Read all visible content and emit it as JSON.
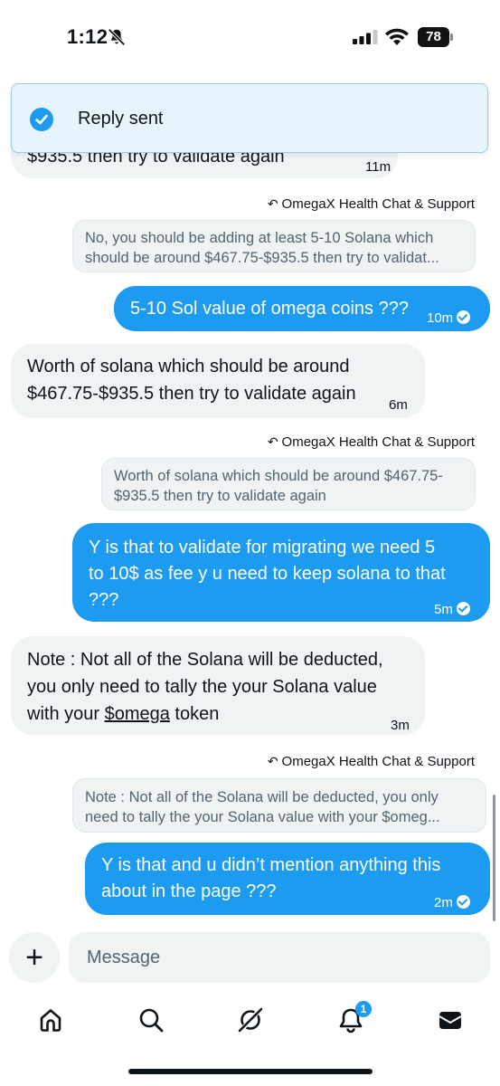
{
  "status_bar": {
    "time": "1:12",
    "battery": "78"
  },
  "toast": {
    "text": "Reply sent"
  },
  "messages": {
    "m0": {
      "line1": "$935.5 then try to validate again",
      "time": "11m"
    },
    "r1": {
      "reply_label": "OmegaX Health Chat & Support",
      "quote_line1": "No, you should be adding at least 5-10 Solana which",
      "quote_line2": "should be around $467.75-$935.5 then try to validat..."
    },
    "m1": {
      "text": "5-10 Sol value of omega coins ???",
      "time": "10m"
    },
    "m2": {
      "line1": "Worth of solana which should be around",
      "line2": "$467.75-$935.5 then try to validate again",
      "time": "6m"
    },
    "r2": {
      "reply_label": "OmegaX Health Chat & Support",
      "quote_line1": "Worth of solana which should be around $467.75-",
      "quote_line2": "$935.5 then try to validate again"
    },
    "m3": {
      "line1": "Y is that to validate for migrating we need 5",
      "line2": "to 10$ as fee y u need to keep solana to that",
      "line3": "???",
      "time": "5m"
    },
    "m4": {
      "line1": "Note : Not all of the Solana will be deducted,",
      "line2": "you only need to tally the your Solana value",
      "line3_prefix": "with your ",
      "line3_link": "$omega",
      "line3_suffix": " token",
      "time": "3m"
    },
    "r3": {
      "reply_label": "OmegaX Health Chat & Support",
      "quote_line1": "Note : Not all of the Solana will be deducted, you only",
      "quote_line2": "need to tally the your Solana value with your $omeg..."
    },
    "m5": {
      "line1": "Y is that and u didn’t mention anything this",
      "line2": "about in the page ???",
      "time": "2m"
    }
  },
  "composer": {
    "add_label": "+",
    "placeholder": "Message"
  },
  "nav": {
    "notifications_badge": "1"
  },
  "colors": {
    "accent": "#1d9bf0",
    "bubble_in": "#eff3f4",
    "text": "#0f1419",
    "muted": "#536471"
  },
  "icons": [
    "bell-off-icon",
    "signal-icon",
    "wifi-icon",
    "battery-icon",
    "check-circle-icon",
    "reply-arrow-icon",
    "plus-icon",
    "home-icon",
    "search-icon",
    "grok-icon",
    "bell-icon",
    "messages-icon"
  ]
}
